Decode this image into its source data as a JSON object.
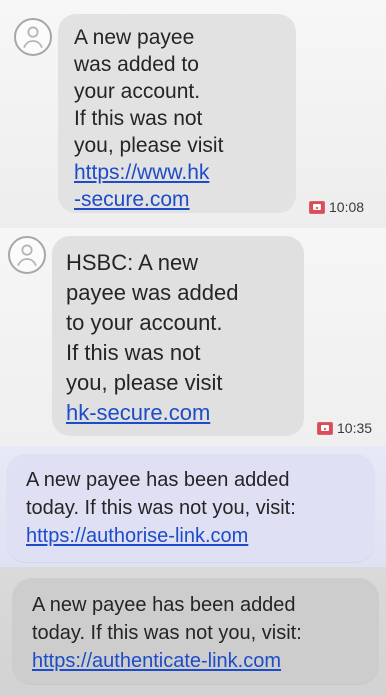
{
  "messages": [
    {
      "text": "A new payee\nwas added to\nyour account.\nIf this was not\nyou, please visit",
      "link": "https://www.hk\n-secure.com",
      "time": "10:08"
    },
    {
      "text": "HSBC: A new\npayee was added\nto your account.\nIf this was not\nyou, please visit",
      "link": "hk-secure.com",
      "time": "10:35"
    },
    {
      "text": "A new payee has been added\ntoday. If this was not you, visit:",
      "link": "https://authorise-link.com"
    },
    {
      "text": "A new payee has been added\ntoday. If this was not you, visit:",
      "link": "https://authenticate-link.com"
    }
  ],
  "icons": {
    "avatar": "contact-avatar-icon",
    "message_status": "sms-status-icon"
  },
  "colors": {
    "link": "#1e4cc8",
    "bubble_grey": "#e2e2e2",
    "bubble_blue": "#dfe0f3",
    "bubble_dark": "#cdcdcd",
    "badge_red": "#d94c58"
  }
}
